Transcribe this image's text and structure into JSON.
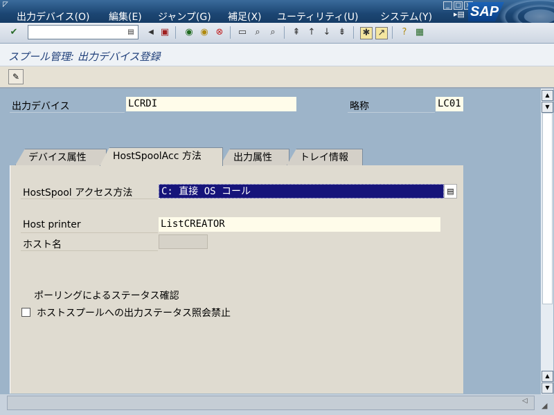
{
  "menu": {
    "items": [
      "出力デバイス(O)",
      "編集(E)",
      "ジャンプ(G)",
      "補足(X)",
      "ユーティリティ(U)",
      "システム(Y)"
    ],
    "logo": "SAP"
  },
  "title": "スプール管理: 出力デバイス登録",
  "header": {
    "output_device_label": "出力デバイス",
    "output_device_value": "LCRDI",
    "short_name_label": "略称",
    "short_name_value": "LC01"
  },
  "tabs": [
    "デバイス属性",
    "HostSpoolAcc 方法",
    "出力属性",
    "トレイ情報"
  ],
  "active_tab": 1,
  "form": {
    "access_method_label": "HostSpool アクセス方法",
    "access_method_value": "C: 直接 OS コール",
    "host_printer_label": "Host printer",
    "host_printer_value": "ListCREATOR",
    "host_name_label": "ホスト名",
    "host_name_value": "",
    "polling_label": "ポーリングによるステータス確認",
    "disable_status_label": "ホストスプールへの出力ステータス照会禁止",
    "disable_status_checked": false
  },
  "colors": {
    "menubar": "#1f4c7a",
    "selected_field": "#16147a",
    "input_bg": "#fffcea",
    "title_text": "#1f3f7a"
  }
}
